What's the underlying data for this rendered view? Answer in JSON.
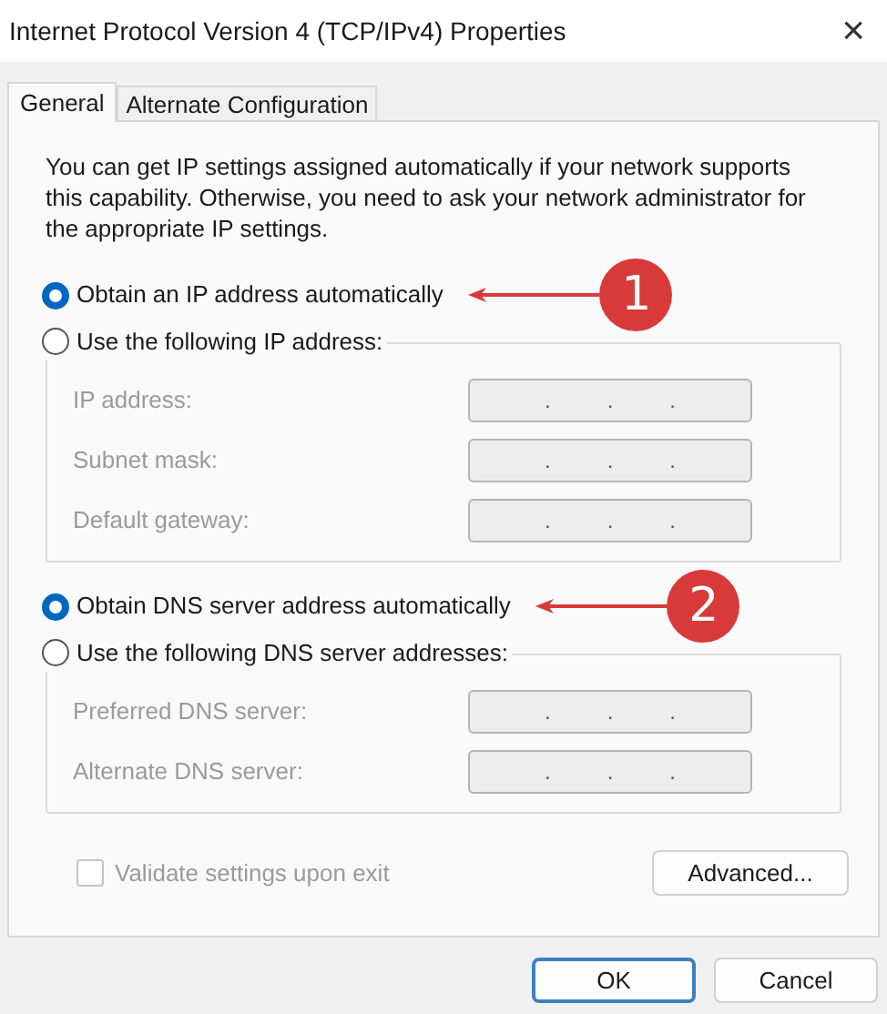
{
  "window": {
    "title": "Internet Protocol Version 4 (TCP/IPv4) Properties",
    "close": "×"
  },
  "tabs": [
    {
      "label": "General",
      "selected": true
    },
    {
      "label": "Alternate Configuration",
      "selected": false
    }
  ],
  "description": "You can get IP settings assigned automatically if your network supports this capability. Otherwise, you need to ask your network administrator for the appropriate IP settings.",
  "sections": [
    {
      "auto_option": {
        "label": "Obtain an IP address automatically",
        "selected": true
      },
      "manual_option": {
        "label": "Use the following IP address:",
        "selected": false
      },
      "disabled": true,
      "fields": [
        {
          "label": "IP address:",
          "separators": [
            ".",
            ".",
            "."
          ]
        },
        {
          "label": "Subnet mask:",
          "separators": [
            ".",
            ".",
            "."
          ]
        },
        {
          "label": "Default gateway:",
          "separators": [
            ".",
            ".",
            "."
          ]
        }
      ],
      "annotation": "1"
    },
    {
      "auto_option": {
        "label": "Obtain DNS server address automatically",
        "selected": true
      },
      "manual_option": {
        "label": "Use the following DNS server addresses:",
        "selected": false
      },
      "disabled": true,
      "fields": [
        {
          "label": "Preferred DNS server:",
          "separators": [
            ".",
            ".",
            "."
          ]
        },
        {
          "label": "Alternate DNS server:",
          "separators": [
            ".",
            ".",
            "."
          ]
        }
      ],
      "annotation": "2"
    }
  ],
  "validate": {
    "label": "Validate settings upon exit",
    "checked": false,
    "disabled": true
  },
  "advanced_button": "Advanced...",
  "buttons": [
    {
      "label": "OK",
      "default": true
    },
    {
      "label": "Cancel",
      "default": false
    }
  ]
}
